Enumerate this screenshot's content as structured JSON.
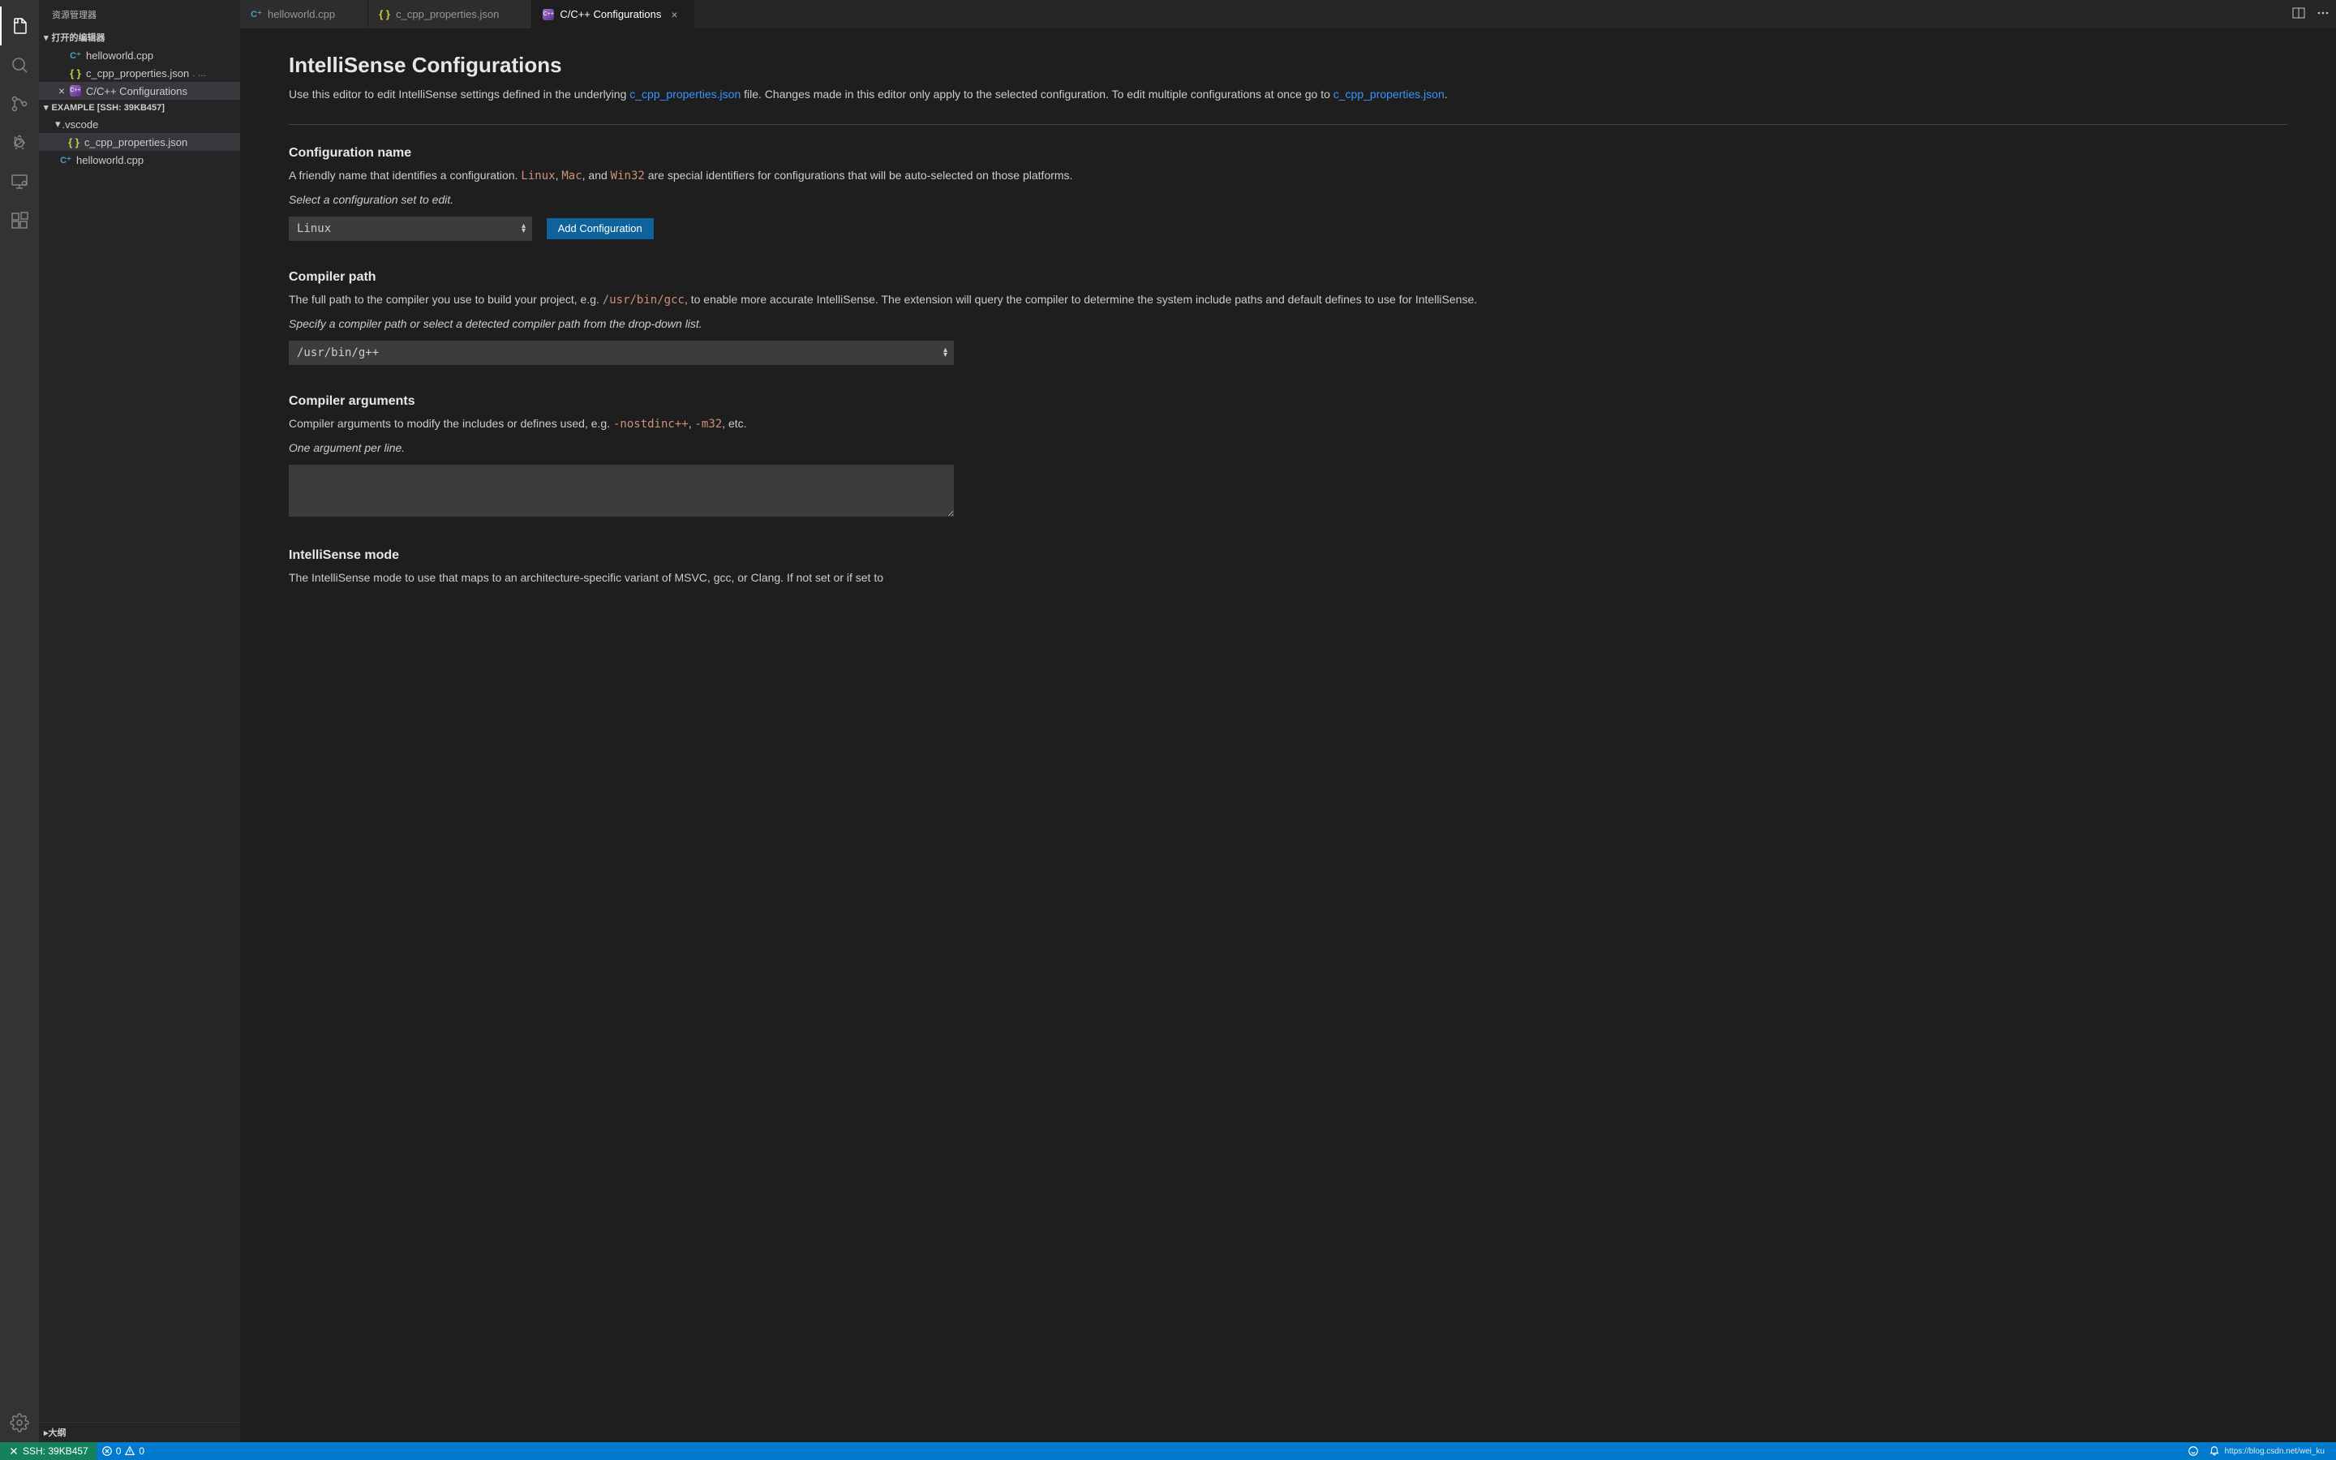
{
  "sidebar": {
    "title": "资源管理器",
    "open_editors_label": "打开的编辑器",
    "workspace_label": "EXAMPLE [SSH: 39KB457]",
    "outline_label": "大纲",
    "open_editors": [
      {
        "label": "helloworld.cpp",
        "icon": "cpp"
      },
      {
        "label": "c_cpp_properties.json",
        "icon": "json",
        "suffix": ". ..."
      },
      {
        "label": "C/C++ Configurations",
        "icon": "cfg",
        "closeable": true
      }
    ],
    "folder_vscode": ".vscode",
    "files": {
      "vscode_json": "c_cpp_properties.json",
      "hello": "helloworld.cpp"
    }
  },
  "tabs": [
    {
      "label": "helloworld.cpp",
      "icon": "cpp"
    },
    {
      "label": "c_cpp_properties.json",
      "icon": "json"
    },
    {
      "label": "C/C++ Configurations",
      "icon": "cfg",
      "active": true
    }
  ],
  "page": {
    "title": "IntelliSense Configurations",
    "intro_a": "Use this editor to edit IntelliSense settings defined in the underlying ",
    "intro_link1": "c_cpp_properties.json",
    "intro_b": " file. Changes made in this editor only apply to the selected configuration. To edit multiple configurations at once go to ",
    "intro_link2": "c_cpp_properties.json",
    "intro_c": ".",
    "config_name": {
      "title": "Configuration name",
      "desc_a": "A friendly name that identifies a configuration. ",
      "code1": "Linux",
      "sep1": ", ",
      "code2": "Mac",
      "sep2": ", and ",
      "code3": "Win32",
      "desc_b": " are special identifiers for configurations that will be auto-selected on those platforms.",
      "hint": "Select a configuration set to edit.",
      "value": "Linux",
      "button": "Add Configuration"
    },
    "compiler_path": {
      "title": "Compiler path",
      "desc_a": "The full path to the compiler you use to build your project, e.g. ",
      "code1": "/usr/bin/gcc",
      "desc_b": ", to enable more accurate IntelliSense. The extension will query the compiler to determine the system include paths and default defines to use for IntelliSense.",
      "hint": "Specify a compiler path or select a detected compiler path from the drop-down list.",
      "value": "/usr/bin/g++"
    },
    "compiler_args": {
      "title": "Compiler arguments",
      "desc_a": "Compiler arguments to modify the includes or defines used, e.g. ",
      "code1": "-nostdinc++",
      "sep1": ", ",
      "code2": "-m32",
      "desc_b": ", etc.",
      "hint": "One argument per line.",
      "value": ""
    },
    "intellisense_mode": {
      "title": "IntelliSense mode",
      "desc_a": "The IntelliSense mode to use that maps to an architecture-specific variant of MSVC, gcc, or Clang. If not set or if set to"
    }
  },
  "status": {
    "remote": "SSH: 39KB457",
    "errors": "0",
    "warnings": "0",
    "watermark": "https://blog.csdn.net/wei_ku"
  }
}
